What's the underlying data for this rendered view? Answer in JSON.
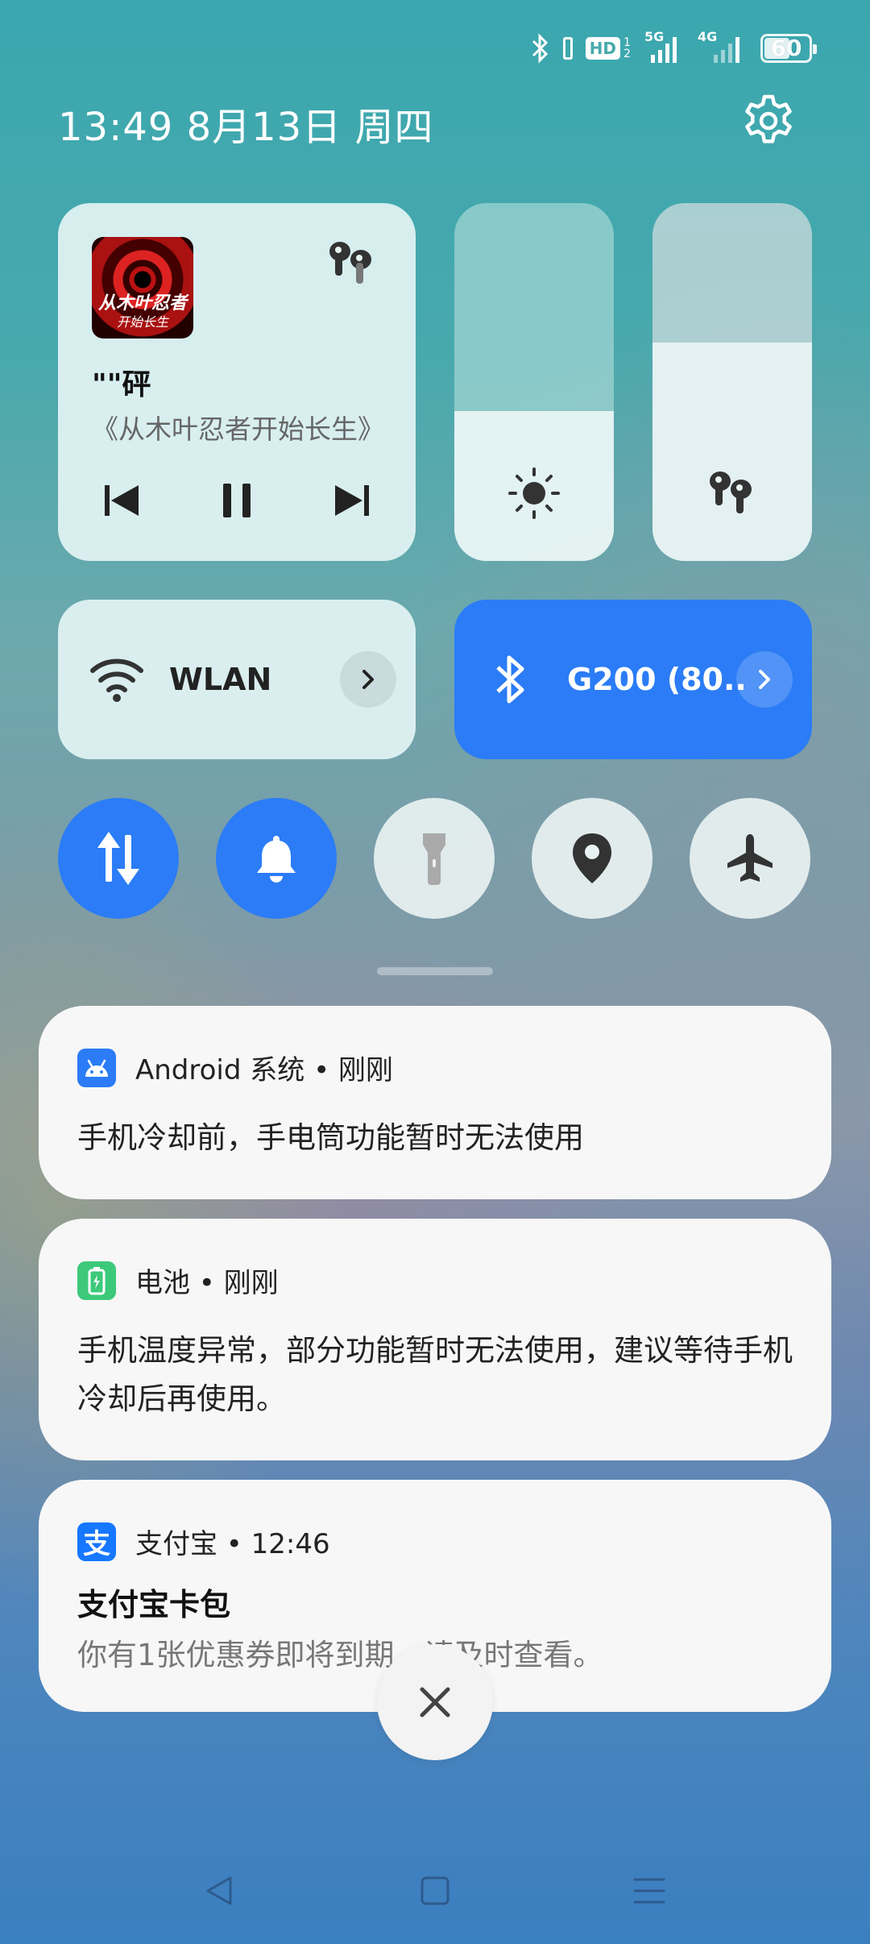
{
  "status_bar": {
    "icons": [
      "bluetooth-icon",
      "hd-voice-icon",
      "5g-signal-icon",
      "4g-signal-icon"
    ],
    "hd_label": "HD",
    "hd_sub": "1 2",
    "net1_label": "5G",
    "net2_label": "4G",
    "battery_level": "60",
    "battery_fraction": 0.6
  },
  "header": {
    "datetime": "13:49 8月13日 周四"
  },
  "media": {
    "album_line1": "从木叶忍者",
    "album_line2": "开始长生",
    "song": "\"\"砰",
    "artist": "《从木叶忍者开始长生》",
    "controls": [
      "previous-icon",
      "pause-icon",
      "next-icon"
    ]
  },
  "sliders": {
    "brightness_level": 0.42,
    "volume_level": 0.61
  },
  "toggles": {
    "wlan_label": "WLAN",
    "bluetooth_label": "G200 (80..",
    "round": [
      {
        "name": "mobile-data",
        "on": true
      },
      {
        "name": "sound",
        "on": true
      },
      {
        "name": "flashlight",
        "on": false
      },
      {
        "name": "location",
        "on": false
      },
      {
        "name": "airplane-mode",
        "on": false
      }
    ]
  },
  "notifications": [
    {
      "app": "Android 系统 • 刚刚",
      "body": "手机冷却前，手电筒功能暂时无法使用",
      "icon_color": "#2b7cf6"
    },
    {
      "app": "电池 • 刚刚",
      "body": "手机温度异常，部分功能暂时无法使用，建议等待手机冷却后再使用。",
      "icon_color": "#3cc97a"
    },
    {
      "app": "支付宝 • 12:46",
      "title": "支付宝卡包",
      "body": "你有1张优惠券即将到期，请及时查看。",
      "icon_color": "#1677ff",
      "icon_char": "支"
    }
  ],
  "colors": {
    "accent": "#2b7cf6"
  }
}
